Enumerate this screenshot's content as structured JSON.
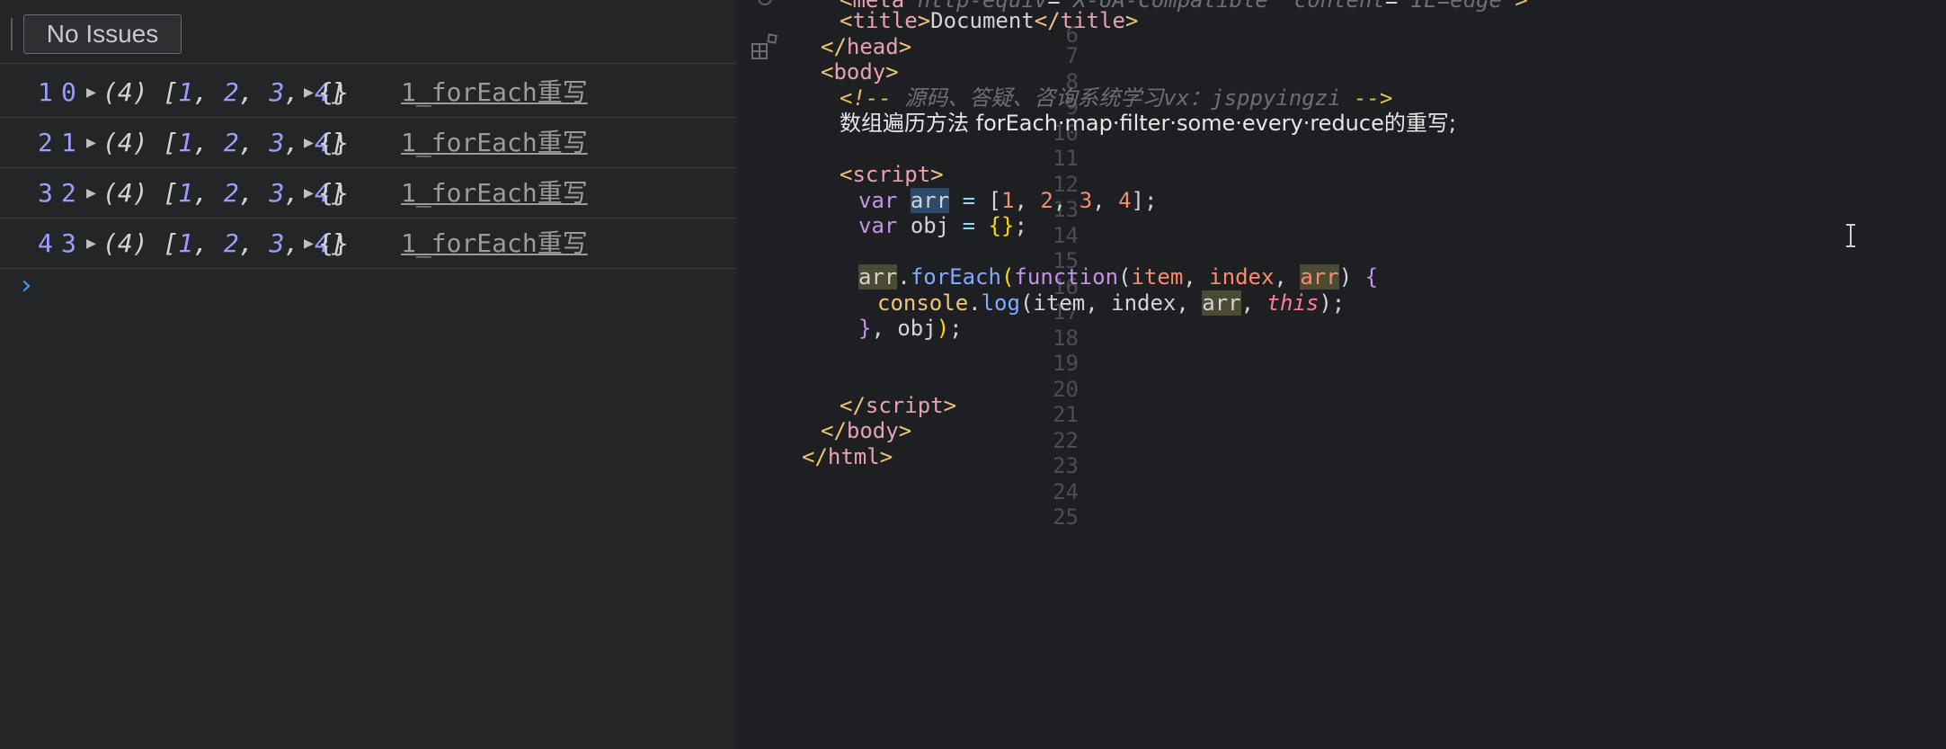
{
  "console": {
    "issues_button": "No Issues",
    "rows": [
      {
        "item": "1",
        "index": "0",
        "count": "(4)",
        "arr": [
          "1",
          "2",
          "3",
          "4"
        ],
        "obj": "{}",
        "source": "1_forEach重写"
      },
      {
        "item": "2",
        "index": "1",
        "count": "(4)",
        "arr": [
          "1",
          "2",
          "3",
          "4"
        ],
        "obj": "{}",
        "source": "1_forEach重写"
      },
      {
        "item": "3",
        "index": "2",
        "count": "(4)",
        "arr": [
          "1",
          "2",
          "3",
          "4"
        ],
        "obj": "{}",
        "source": "1_forEach重写"
      },
      {
        "item": "4",
        "index": "3",
        "count": "(4)",
        "arr": [
          "1",
          "2",
          "3",
          "4"
        ],
        "obj": "{}",
        "source": "1_forEach重写"
      }
    ],
    "prompt": "›"
  },
  "side_icons": [
    "debug-icon",
    "extensions-icon"
  ],
  "editor": {
    "line_numbers": [
      "6",
      "7",
      "8",
      "9",
      "10",
      "11",
      "12",
      "13",
      "14",
      "15",
      "16",
      "17",
      "18",
      "19",
      "20",
      "21",
      "22",
      "23",
      "24",
      "25"
    ],
    "lines": {
      "l7_title": "Document",
      "l10_comment": "源码、答疑、咨询系统学习vx：jsppyingzi",
      "l11_text": "数组遍历方法 forEach·map·filter·some·every·reduce的重写;",
      "l14": {
        "kw": "var",
        "name": "arr",
        "values": [
          "1",
          "2",
          "3",
          "4"
        ]
      },
      "l15": {
        "kw": "var",
        "name": "obj"
      },
      "l17": {
        "obj": "arr",
        "method": "forEach",
        "fn": "function",
        "p1": "item",
        "p2": "index",
        "p3": "arr"
      },
      "l18": {
        "obj": "console",
        "method": "log",
        "a1": "item",
        "a2": "index",
        "a3": "arr",
        "a4": "this"
      },
      "l19": {
        "arg": "obj"
      }
    }
  },
  "colors": {
    "console_bg": "#242526",
    "editor_bg": "#1e1f22",
    "number": "#9d9dff",
    "tag_bracket": "#f0c674",
    "tag_name": "#e8a1b0",
    "keyword": "#c792ea",
    "function": "#82aaff",
    "number_literal": "#f78c6c"
  }
}
